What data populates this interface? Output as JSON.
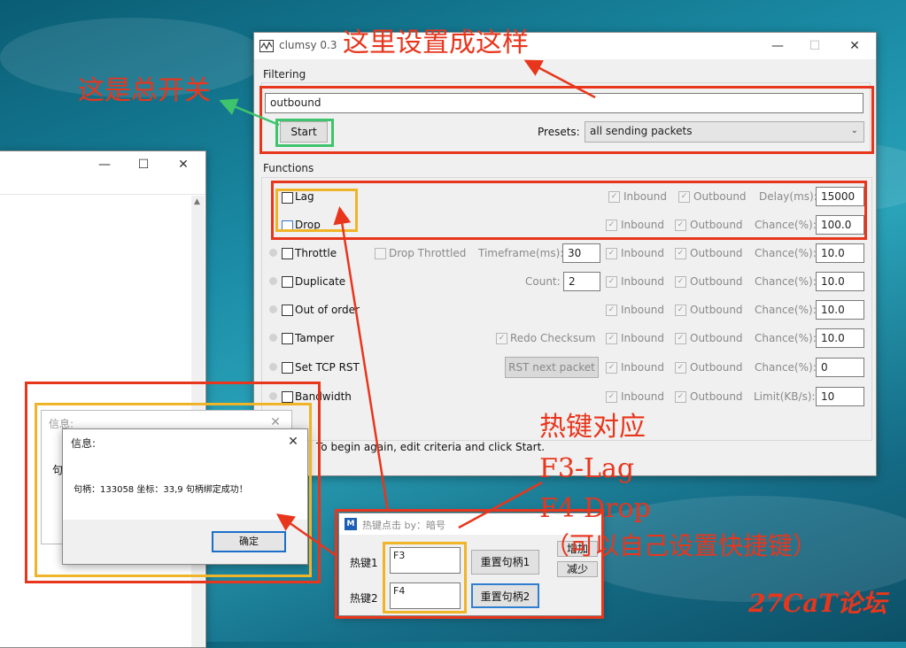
{
  "clumsy": {
    "title": "clumsy 0.3",
    "filtering_label": "Filtering",
    "filter_value": "outbound",
    "start_label": "Start",
    "presets_label": "Presets:",
    "presets_value": "all sending packets",
    "functions_label": "Functions",
    "status": "To begin again, edit criteria and click Start.",
    "inbound": "Inbound",
    "outbound": "Outbound",
    "rows": [
      {
        "name": "Lag",
        "param_label": "Delay(ms):",
        "param_value": "15000"
      },
      {
        "name": "Drop",
        "param_label": "Chance(%):",
        "param_value": "100.0"
      },
      {
        "name": "Throttle",
        "extra_check": "Drop Throttled",
        "extra_label": "Timeframe(ms):",
        "extra_value": "30",
        "param_label": "Chance(%):",
        "param_value": "10.0"
      },
      {
        "name": "Duplicate",
        "extra_label": "Count:",
        "extra_value": "2",
        "param_label": "Chance(%):",
        "param_value": "10.0"
      },
      {
        "name": "Out of order",
        "param_label": "Chance(%):",
        "param_value": "10.0"
      },
      {
        "name": "Tamper",
        "extra_check": "Redo Checksum",
        "param_label": "Chance(%):",
        "param_value": "10.0"
      },
      {
        "name": "Set TCP RST",
        "extra_button": "RST next packet",
        "param_label": "Chance(%):",
        "param_value": "0"
      },
      {
        "name": "Bandwidth",
        "param_label": "Limit(KB/s):",
        "param_value": "10"
      }
    ]
  },
  "msgbox_back": {
    "title": "信息:",
    "fragment": "句"
  },
  "msgbox": {
    "title": "信息:",
    "message": "句柄：133058   坐标：33,9   句柄绑定成功！",
    "ok_label": "确定"
  },
  "hotkey": {
    "title": "热键点击   by：暗号",
    "hotkey1_label": "热键1",
    "hotkey1_value": "F3",
    "hotkey2_label": "热键2",
    "hotkey2_value": "F4",
    "reset1_label": "重置句柄1",
    "reset2_label": "重置句柄2",
    "add_label": "增加",
    "reduce_label": "减少"
  },
  "annotations": {
    "set_like_this": "这里设置成这样",
    "master_switch": "这是总开关",
    "hotkey_map": "热键对应",
    "f3": "F3-Lag",
    "f4": "F4-Drop",
    "custom": "（可以自己设置快捷键）",
    "watermark": "27CaT论坛"
  },
  "colors": {
    "annotation_red": "#e8361d",
    "green_box": "#3ec46d",
    "yellow_box": "#f0b429"
  }
}
